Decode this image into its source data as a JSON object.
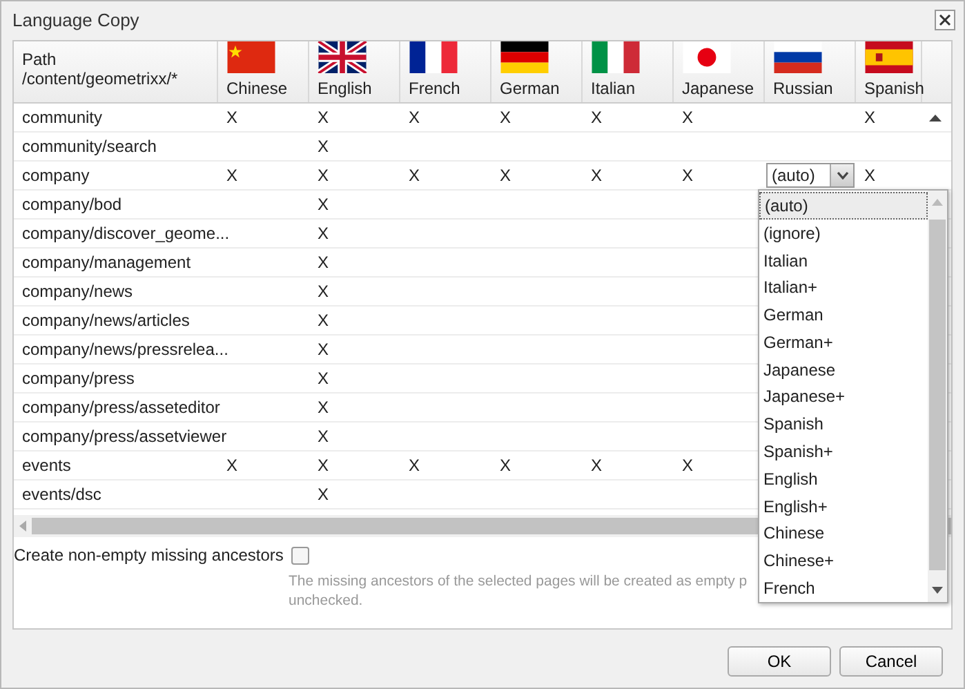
{
  "window": {
    "title": "Language Copy"
  },
  "table": {
    "path_header": [
      "Path",
      "/content/geometrixx/*"
    ],
    "columns": [
      {
        "label": "Chinese"
      },
      {
        "label": "English"
      },
      {
        "label": "French"
      },
      {
        "label": "German"
      },
      {
        "label": "Italian"
      },
      {
        "label": "Japanese"
      },
      {
        "label": "Russian"
      },
      {
        "label": "Spanish"
      }
    ],
    "rows": [
      {
        "path": "community",
        "cells": [
          "X",
          "X",
          "X",
          "X",
          "X",
          "X",
          null,
          "X"
        ]
      },
      {
        "path": "community/search",
        "cells": [
          null,
          "X",
          null,
          null,
          null,
          null,
          null,
          null
        ]
      },
      {
        "path": "company",
        "cells": [
          "X",
          "X",
          "X",
          "X",
          "X",
          "X",
          {
            "kind": "select",
            "value": "(auto)",
            "expanded": true,
            "options": [
              {
                "label": "(auto)",
                "selected": true
              },
              {
                "label": "(ignore)",
                "selected": false
              },
              {
                "label": "Italian",
                "selected": false
              },
              {
                "label": "Italian+",
                "selected": false
              },
              {
                "label": "German",
                "selected": false
              },
              {
                "label": "German+",
                "selected": false
              },
              {
                "label": "Japanese",
                "selected": false
              },
              {
                "label": "Japanese+",
                "selected": false
              },
              {
                "label": "Spanish",
                "selected": false
              },
              {
                "label": "Spanish+",
                "selected": false
              },
              {
                "label": "English",
                "selected": false
              },
              {
                "label": "English+",
                "selected": false
              },
              {
                "label": "Chinese",
                "selected": false
              },
              {
                "label": "Chinese+",
                "selected": false
              },
              {
                "label": "French",
                "selected": false
              }
            ]
          },
          "X"
        ]
      },
      {
        "path": "company/bod",
        "cells": [
          null,
          "X",
          null,
          null,
          null,
          null,
          null,
          null
        ]
      },
      {
        "path": "company/discover_geome...",
        "cells": [
          null,
          "X",
          null,
          null,
          null,
          null,
          null,
          null
        ]
      },
      {
        "path": "company/management",
        "cells": [
          null,
          "X",
          null,
          null,
          null,
          null,
          null,
          null
        ]
      },
      {
        "path": "company/news",
        "cells": [
          null,
          "X",
          null,
          null,
          null,
          null,
          null,
          null
        ]
      },
      {
        "path": "company/news/articles",
        "cells": [
          null,
          "X",
          null,
          null,
          null,
          null,
          null,
          null
        ]
      },
      {
        "path": "company/news/pressrelea...",
        "cells": [
          null,
          "X",
          null,
          null,
          null,
          null,
          null,
          null
        ]
      },
      {
        "path": "company/press",
        "cells": [
          null,
          "X",
          null,
          null,
          null,
          null,
          null,
          null
        ]
      },
      {
        "path": "company/press/asseteditor",
        "cells": [
          null,
          "X",
          null,
          null,
          null,
          null,
          null,
          null
        ]
      },
      {
        "path": "company/press/assetviewer",
        "cells": [
          null,
          "X",
          null,
          null,
          null,
          null,
          null,
          null
        ]
      },
      {
        "path": "events",
        "cells": [
          "X",
          "X",
          "X",
          "X",
          "X",
          "X",
          null,
          null
        ]
      },
      {
        "path": "events/dsc",
        "cells": [
          null,
          "X",
          null,
          null,
          null,
          null,
          null,
          null
        ]
      }
    ]
  },
  "option": {
    "label": "Create non-empty missing ancestors",
    "checked": false,
    "hint_lines": [
      "The missing ancestors of the selected pages will be created as empty p",
      "unchecked."
    ]
  },
  "buttons": [
    "OK",
    "Cancel"
  ]
}
